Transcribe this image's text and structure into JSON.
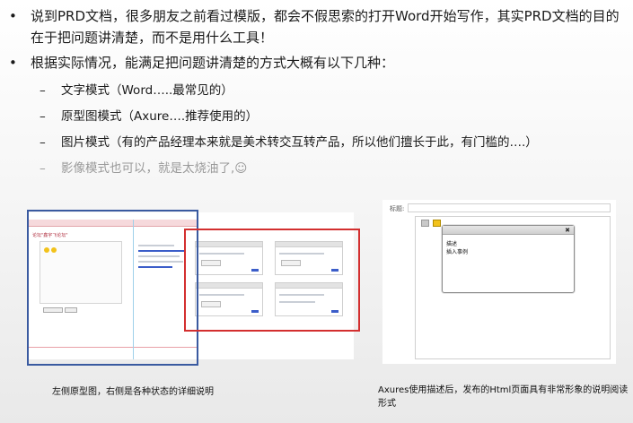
{
  "bullets": [
    {
      "text": "说到PRD文档，很多朋友之前看过模版，都会不假思索的打开Word开始写作，其实PRD文档的目的在于把问题讲清楚，而不是用什么工具！"
    },
    {
      "text": "根据实际情况，能满足把问题讲清楚的方式大概有以下几种："
    }
  ],
  "sub_bullets": [
    {
      "text": "文字模式（Word…..最常见的）"
    },
    {
      "text": "原型图模式（Axure….推荐使用的）"
    },
    {
      "text": "图片模式（有的产品经理本来就是美术转交互转产品，所以他们擅长于此，有门槛的….）"
    },
    {
      "text": "影像模式也可以，就是太烧油了,☺"
    }
  ],
  "bullet_symbol": "•",
  "dash_symbol": "–",
  "left_figure": {
    "caption": "左侧原型图，右侧是各种状态的详细说明",
    "heading": "论坛\"鑫宇飞论坛\"",
    "highlight_color": "#d32f2f",
    "frame_color": "#3a5aa0"
  },
  "right_figure": {
    "label": "标题:",
    "popup_line1": "描述",
    "popup_line2": "插入事例",
    "close_symbol": "✖",
    "caption": "Axures使用描述后，发布的Html页面具有非常形象的说明阅读形式"
  }
}
